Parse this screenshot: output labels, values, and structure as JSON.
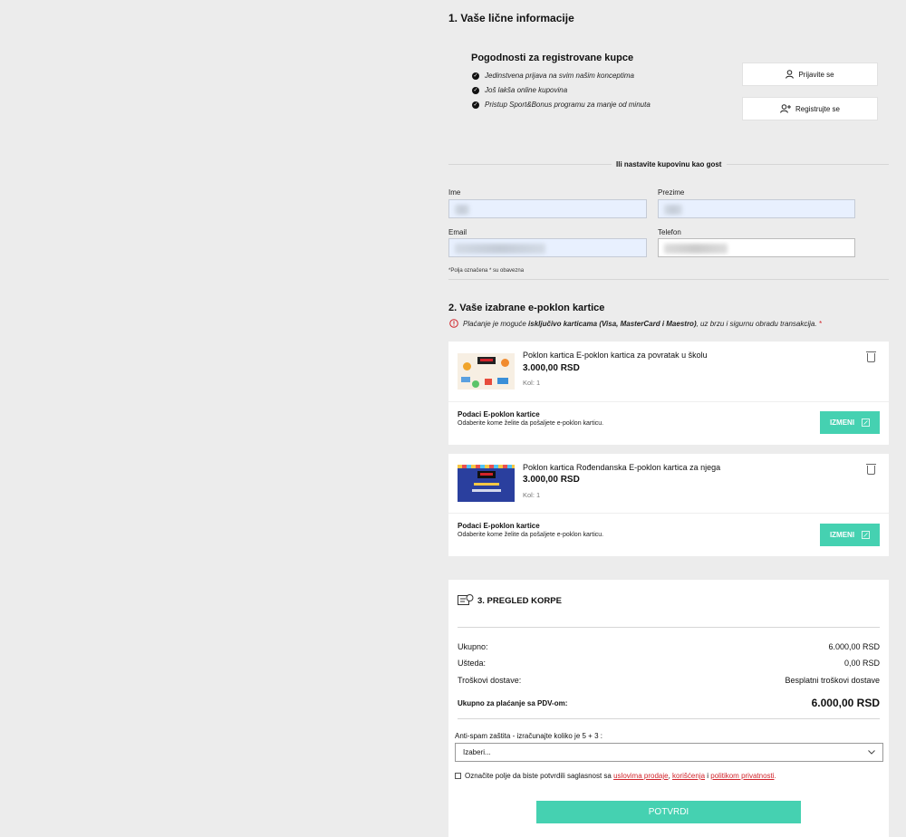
{
  "section1": {
    "title": "1. Vaše lične informacije",
    "benefits_title": "Pogodnosti za registrovane kupce",
    "benefits": [
      "Jedinstvena prijava na svim našim konceptima",
      "Još lakša online kupovina",
      "Pristup Sport&Bonus programu za manje od minuta"
    ],
    "login_label": "Prijavite se",
    "register_label": "Registrujte se",
    "guest_label": "Ili nastavite kupovinu kao gost",
    "fields": {
      "first_name_label": "Ime",
      "last_name_label": "Prezime",
      "email_label": "Email",
      "phone_label": "Telefon"
    },
    "required_note": "*Polja označena * su obavezna"
  },
  "section2": {
    "title": "2. Vaše izabrane e-poklon kartice",
    "notice_prefix": "Plaćanje je moguće ",
    "notice_bold": "isključivo karticama (Visa, MasterCard i Maestro)",
    "notice_suffix": ", uz brzu i sigurnu obradu transakcija.",
    "notice_star": " *",
    "items": [
      {
        "name": "Poklon kartica E-poklon kartica za povratak u školu",
        "price": "3.000,00 RSD",
        "qty": "Kol: 1",
        "details_title": "Podaci E-poklon kartice",
        "details_desc": "Odaberite kome želite da pošaljete e-poklon karticu.",
        "edit_label": "IZMENI"
      },
      {
        "name": "Poklon kartica Rođendanska E-poklon kartica za njega",
        "price": "3.000,00 RSD",
        "qty": "Kol: 1",
        "details_title": "Podaci E-poklon kartice",
        "details_desc": "Odaberite kome želite da pošaljete e-poklon karticu.",
        "edit_label": "IZMENI"
      }
    ]
  },
  "section3": {
    "title": "3. PREGLED KORPE",
    "rows": [
      {
        "label": "Ukupno:",
        "value": "6.000,00 RSD"
      },
      {
        "label": "Ušteda:",
        "value": "0,00 RSD"
      },
      {
        "label": "Troškovi dostave:",
        "value": "Besplatni troškovi dostave"
      }
    ],
    "total_label": "Ukupno za plaćanje sa PDV-om:",
    "total_value": "6.000,00 RSD",
    "antispam_label": "Anti-spam zaštita - izračunajte koliko je 5 + 3 :",
    "antispam_selected": "Izaberi...",
    "consent_prefix": "Označite polje da biste potvrdili saglasnost sa ",
    "consent_link1": "uslovima prodaje",
    "consent_sep1": ", ",
    "consent_link2": "korišćenja",
    "consent_sep2": " i ",
    "consent_link3": "politikom privatnosti",
    "consent_suffix": ".",
    "confirm_label": "POTVRDI"
  },
  "colors": {
    "accent": "#45d1b1",
    "link": "#d1232a",
    "background": "#ececec"
  }
}
